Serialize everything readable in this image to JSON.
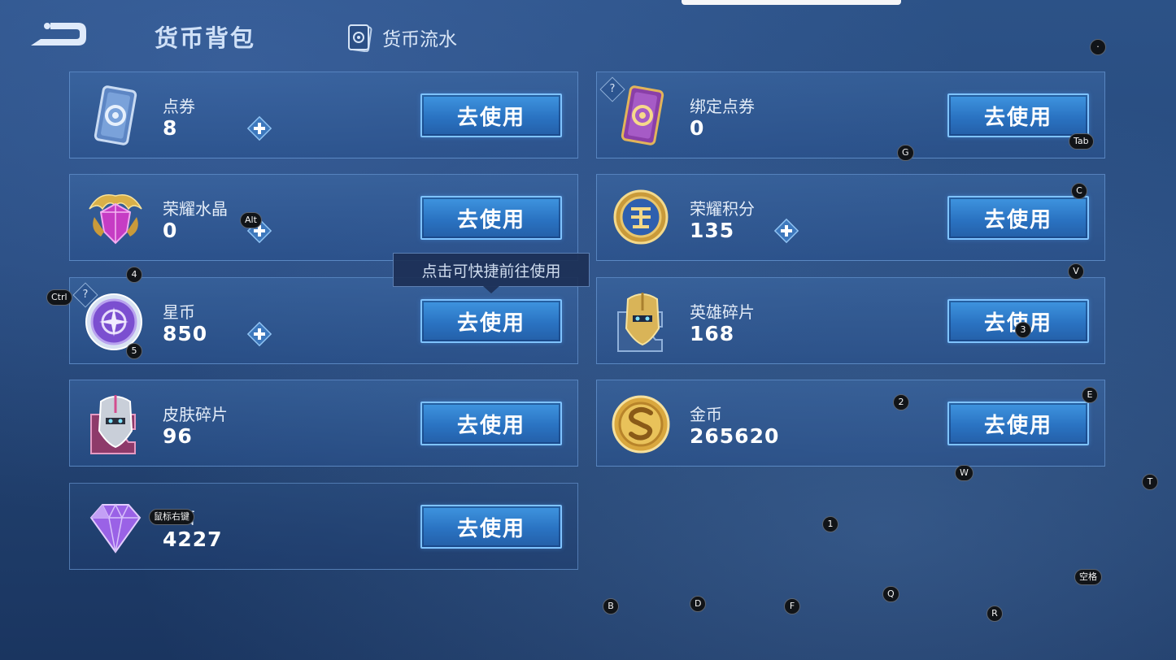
{
  "header": {
    "title": "货币背包",
    "flow_tab": "货币流水"
  },
  "tooltip": "点击可快捷前往使用",
  "cards": [
    {
      "name": "点券",
      "value": "8",
      "button": "去使用",
      "icon": "ticket-blue-icon",
      "has_plus": true
    },
    {
      "name": "绑定点券",
      "value": "0",
      "button": "去使用",
      "icon": "ticket-purple-icon",
      "has_help": true
    },
    {
      "name": "荣耀水晶",
      "value": "0",
      "button": "去使用",
      "icon": "crystal-icon",
      "has_plus": true
    },
    {
      "name": "荣耀积分",
      "value": "135",
      "button": "去使用",
      "icon": "points-medal-icon",
      "has_plus": true
    },
    {
      "name": "星币",
      "value": "850",
      "button": "去使用",
      "icon": "star-coin-icon",
      "has_plus": true,
      "has_help": true
    },
    {
      "name": "英雄碎片",
      "value": "168",
      "button": "去使用",
      "icon": "hero-shard-icon"
    },
    {
      "name": "皮肤碎片",
      "value": "96",
      "button": "去使用",
      "icon": "skin-shard-icon"
    },
    {
      "name": "金币",
      "value": "265620",
      "button": "去使用",
      "icon": "gold-coin-icon"
    },
    {
      "name": "钻石",
      "value": "4227",
      "button": "去使用",
      "icon": "diamond-icon"
    }
  ],
  "key_hints": {
    "tab": "Tab",
    "g": "G",
    "c": "C",
    "alt": "Alt",
    "v": "V",
    "four": "4",
    "ctrl": "Ctrl",
    "three": "3",
    "five": "5",
    "two": "2",
    "e": "E",
    "w": "W",
    "t": "T",
    "mouse_right": "鼠标右键",
    "one": "1",
    "space": "空格",
    "b": "B",
    "d": "D",
    "f": "F",
    "q": "Q",
    "r": "R",
    "dot": "·"
  }
}
